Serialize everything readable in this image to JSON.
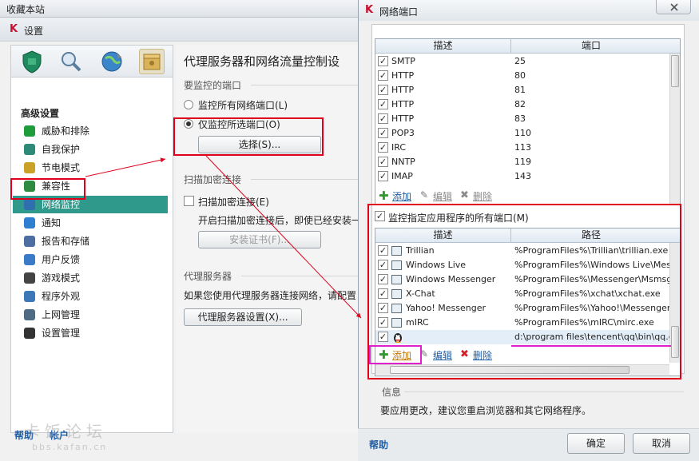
{
  "favorites_bar": {
    "label": "收藏本站"
  },
  "settings_window": {
    "title": "设置",
    "icon_tabs": [
      {
        "name": "protection-shield-icon"
      },
      {
        "name": "scan-magnifier-icon"
      },
      {
        "name": "update-globe-icon"
      },
      {
        "name": "settings-box-icon"
      }
    ],
    "advanced_title": "高级设置",
    "nav_items": [
      {
        "label": "威胁和排除",
        "icon": "check-circle-icon",
        "color": "#1e9c3c"
      },
      {
        "label": "自我保护",
        "icon": "k-shield-icon",
        "color": "#2e8a78"
      },
      {
        "label": "节电模式",
        "icon": "battery-icon",
        "color": "#c9a227"
      },
      {
        "label": "兼容性",
        "icon": "checkbox-icon",
        "color": "#2e8a3e"
      },
      {
        "label": "网络监控",
        "icon": "network-icon",
        "color": "#2f6fb0",
        "active": true
      },
      {
        "label": "通知",
        "icon": "info-icon",
        "color": "#2f7fd0"
      },
      {
        "label": "报告和存储",
        "icon": "report-icon",
        "color": "#4c6ea0"
      },
      {
        "label": "用户反馈",
        "icon": "feedback-arrows-icon",
        "color": "#3a7bc8"
      },
      {
        "label": "游戏模式",
        "icon": "gamepad-icon",
        "color": "#444444"
      },
      {
        "label": "程序外观",
        "icon": "window-icon",
        "color": "#3c78b8"
      },
      {
        "label": "上网管理",
        "icon": "user-icon",
        "color": "#4e6b86"
      },
      {
        "label": "设置管理",
        "icon": "floppy-icon",
        "color": "#333333"
      }
    ],
    "main": {
      "title": "代理服务器和网络流量控制设",
      "ports_section": "要监控的端口",
      "radio_all": "监控所有网络端口(L)",
      "radio_selected": "仅监控所选端口(O)",
      "select_button": "选择(S)...",
      "scan_section": "扫描加密连接",
      "scan_checkbox": "扫描加密连接(E)",
      "scan_desc": "开启扫描加密连接后，即使已经安装一",
      "install_cert_button": "安装证书(F)...",
      "proxy_section": "代理服务器",
      "proxy_desc": "如果您使用代理服务器连接网络，请配置",
      "proxy_button": "代理服务器设置(X)..."
    },
    "footer": {
      "help": "帮助",
      "help2": "帐户"
    },
    "watermark": {
      "text": "卡饭论坛",
      "url": "bbs.kafan.cn"
    }
  },
  "dialog": {
    "title": "网络端口",
    "ports_table": {
      "headers": [
        "描述",
        "端口"
      ],
      "rows": [
        {
          "desc": "SMTP",
          "port": "25"
        },
        {
          "desc": "HTTP",
          "port": "80"
        },
        {
          "desc": "HTTP",
          "port": "81"
        },
        {
          "desc": "HTTP",
          "port": "82"
        },
        {
          "desc": "HTTP",
          "port": "83"
        },
        {
          "desc": "POP3",
          "port": "110"
        },
        {
          "desc": "IRC",
          "port": "113"
        },
        {
          "desc": "NNTP",
          "port": "119"
        },
        {
          "desc": "IMAP",
          "port": "143"
        }
      ]
    },
    "ports_actions": {
      "add": "添加",
      "edit": "编辑",
      "delete": "删除"
    },
    "monitor_apps_checkbox": "监控指定应用程序的所有端口(M)",
    "apps_table": {
      "headers": [
        "描述",
        "路径"
      ],
      "rows": [
        {
          "desc": "Trillian",
          "path": "%ProgramFiles%\\Trillian\\trillian.exe"
        },
        {
          "desc": "Windows Live",
          "path": "%ProgramFiles%\\Windows Live\\Messe"
        },
        {
          "desc": "Windows Messenger",
          "path": "%ProgramFiles%\\Messenger\\Msmsgs."
        },
        {
          "desc": "X-Chat",
          "path": "%ProgramFiles%\\xchat\\xchat.exe"
        },
        {
          "desc": "Yahoo! Messenger",
          "path": "%ProgramFiles%\\Yahoo!\\Messenger\\Y"
        },
        {
          "desc": "mIRC",
          "path": "%ProgramFiles%\\mIRC\\mirc.exe"
        },
        {
          "desc": "",
          "path": "d:\\program files\\tencent\\qq\\bin\\qq.ex",
          "icon": "qq-penguin-icon"
        }
      ]
    },
    "apps_actions": {
      "add": "添加",
      "edit": "编辑",
      "delete": "删除"
    },
    "info_label": "信息",
    "info_text": "要应用更改，建议您重启浏览器和其它网络程序。",
    "help": "帮助",
    "ok": "确定",
    "cancel": "取消"
  }
}
